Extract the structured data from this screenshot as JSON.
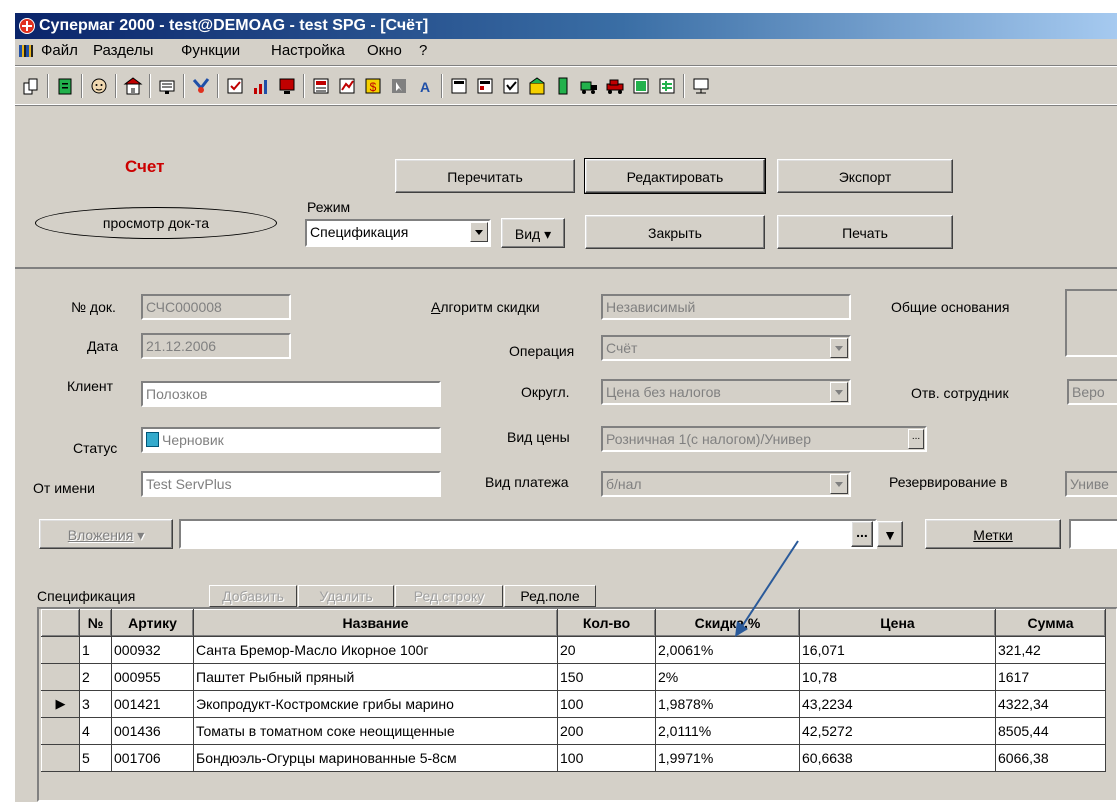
{
  "window": {
    "title": "Супермаг 2000 - test@DEMOAG - test SPG - [Счёт]"
  },
  "menu": [
    "Файл",
    "Разделы",
    "Функции",
    "Настройка",
    "Окно",
    "?"
  ],
  "header": {
    "doc_title": "Счет",
    "mode_oval": "просмотр док-та",
    "mode_label": "Режим",
    "mode_value": "Спецификация",
    "view_button": "Вид",
    "reload_button": "Перечитать",
    "edit_button": "Редактировать",
    "export_button": "Экспорт",
    "close_button": "Закрыть",
    "print_button": "Печать"
  },
  "form": {
    "doc_no_label": "№ док.",
    "doc_no": "СЧС000008",
    "date_label": "Дата",
    "date": "21.12.2006",
    "client_label": "Клиент",
    "client": "Полозков",
    "status_label": "Статус",
    "status": "Черновик",
    "from_label": "От имени",
    "from": "Test ServPlus",
    "discount_algo_label": "Алгоритм скидки",
    "discount_algo": "Независимый",
    "operation_label": "Операция",
    "operation": "Счёт",
    "rounding_label": "Округл.",
    "rounding": "Цена без налогов",
    "price_type_label": "Вид цены",
    "price_type": "Розничная 1(с налогом)/Универ",
    "payment_label": "Вид платежа",
    "payment": "б/нал",
    "general_basis_label": "Общие основания",
    "responsible_label": "Отв. сотрудник",
    "responsible": "Веро",
    "reserve_label": "Резервирование в",
    "reserve": "Униве",
    "attachments_button": "Вложения",
    "tags_button": "Метки"
  },
  "spec": {
    "label": "Спецификация",
    "add_button": "Добавить",
    "delete_button": "Удалить",
    "edit_row_button": "Ред.строку",
    "edit_field_button": "Ред.поле",
    "columns": [
      "№",
      "Артику",
      "Название",
      "Кол-во",
      "Скидка,%",
      "Цена",
      "Сумма"
    ],
    "rows": [
      [
        "1",
        "000932",
        "Санта Бремор-Масло Икорное 100г",
        "20",
        "2,0061%",
        "16,071",
        "321,42"
      ],
      [
        "2",
        "000955",
        "Паштет Рыбный пряный",
        "150",
        "2%",
        "10,78",
        "1617"
      ],
      [
        "3",
        "001421",
        "Экопродукт-Костромские грибы марино",
        "100",
        "1,9878%",
        "43,2234",
        "4322,34"
      ],
      [
        "4",
        "001436",
        "Томаты в томатном соке неощищенные",
        "200",
        "2,0111%",
        "42,5272",
        "8505,44"
      ],
      [
        "5",
        "001706",
        "Бондюэль-Огурцы маринованные 5-8см",
        "100",
        "1,9971%",
        "60,6638",
        "6066,38"
      ]
    ],
    "current_row": 2
  }
}
